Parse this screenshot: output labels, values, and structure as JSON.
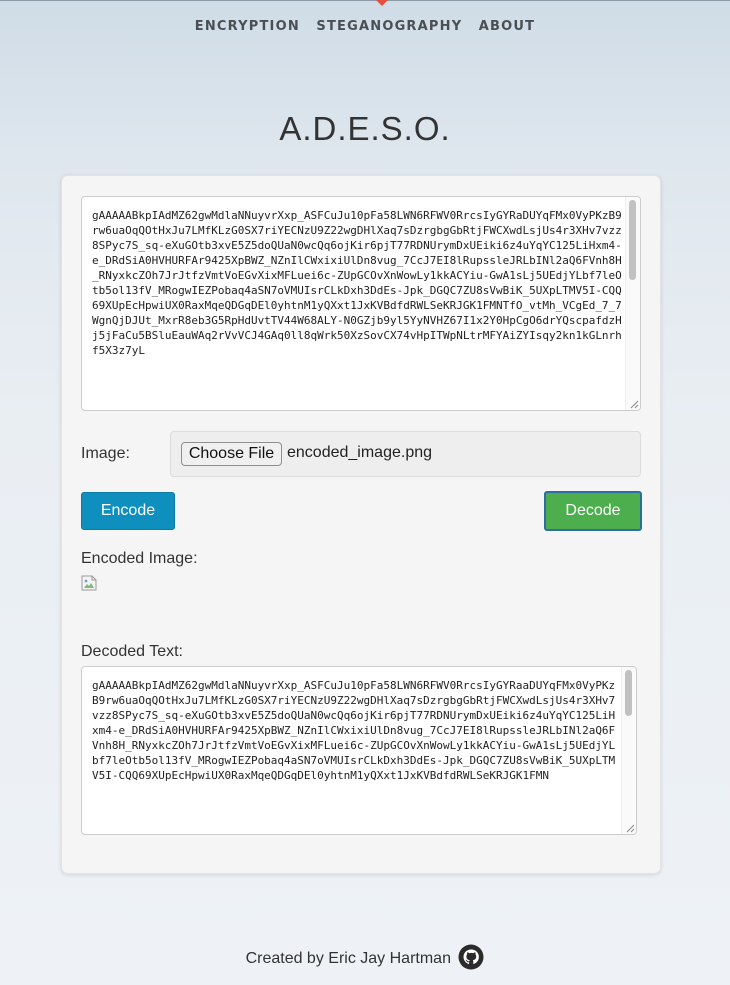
{
  "nav": {
    "items": [
      {
        "label": "ENCRYPTION"
      },
      {
        "label": "STEGANOGRAPHY"
      },
      {
        "label": "ABOUT"
      }
    ]
  },
  "title": "A.D.E.S.O.",
  "input_text": "gAAAAABkpIAdMZ62gwMdlaNNuyvrXxp_ASFCuJu10pFa58LWN6RFWV0RrcsIyGYRaDUYqFMx0VyPKzB9rw6uaOqQOtHxJu7LMfKLzG0SX7riYECNzU9Z22wgDHlXaq7sDzrgbgGbRtjFWCXwdLsjUs4r3XHv7vzz8SPyc7S_sq-eXuGOtb3xvE5Z5doQUaN0wcQq6ojKir6pjT77RDNUrymDxUEiki6z4uYqYC125LiHxm4-e_DRdSiA0HVHURFAr9425XpBWZ_NZnIlCWxixiUlDn8vug_7CcJ7EI8lRupssleJRLbINl2aQ6FVnh8H_RNyxkcZOh7JrJtfzVmtVoEGvXixMFLuei6c-ZUpGCOvXnWowLy1kkACYiu-GwA1sLj5UEdjYLbf7leOtb5ol13fV_MRogwIEZPobaq4aSN7oVMUIsrCLkDxh3DdEs-Jpk_DGQC7ZU8sVwBiK_5UXpLTMV5I-CQQ69XUpEcHpwiUX0RaxMqeQDGqDEl0yhtnM1yQXxt1JxKVBdfdRWLSeKRJGK1FMNTfO_vtMh_VCgEd_7_7WgnQjDJUt_MxrR8eb3G5RpHdUvtTV44W68ALY-N0GZjb9yl5YyNVHZ67I1x2Y0HpCgO6drYQscpafdzHj5jFaCu5BSluEauWAq2rVvVCJ4GAq0ll8qWrk50XzSovCX74vHpITWpNLtrMFYAiZYIsqy2kn1kGLnrhf5X3z7yL",
  "image": {
    "label": "Image:",
    "button_label": "Choose File",
    "file_name": "encoded_image.png"
  },
  "buttons": {
    "encode": "Encode",
    "decode": "Decode"
  },
  "encoded_image_label": "Encoded Image:",
  "decoded_text_label": "Decoded Text:",
  "decoded_text": "gAAAAABkpIAdMZ62gwMdlaNNuyvrXxp_ASFCuJu10pFa58LWN6RFWV0RrcsIyGYRaaDUYqFMx0VyPKzB9rw6uaOqQOtHxJu7LMfKLzG0SX7riYECNzU9Z22wgDHlXaq7sDzrgbgGbRtjFWCXwdLsjUs4r3XHv7vzz8SPyc7S_sq-eXuGOtb3xvE5Z5doQUaN0wcQq6ojKir6pjT77RDNUrymDxUEiki6z4uYqYC125LiHxm4-e_DRdSiA0HVHURFAr9425XpBWZ_NZnIlCWxixiUlDn8vug_7CcJ7EI8lRupssleJRLbINl2aQ6FVnh8H_RNyxkcZOh7JrJtfzVmtVoEGvXixMFLuei6c-ZUpGCOvXnWowLy1kkACYiu-GwA1sLj5UEdjYLbf7leOtb5ol13fV_MRogwIEZPobaq4aSN7oVMUIsrCLkDxh3DdEs-Jpk_DGQC7ZU8sVwBiK_5UXpLTMV5I-CQQ69XUpEcHpwiUX0RaxMqeQDGqDEl0yhtnM1yQXxt1JxKVBdfdRWLSeKRJGK1FMN",
  "footer": {
    "text": "Created by Eric Jay Hartman"
  },
  "colors": {
    "encode_button": "#0e8fbd",
    "decode_button": "#4cae4c",
    "nav_marker": "#e74c3c"
  },
  "icons": {
    "footer_icon": "github-icon",
    "encoded_image": "broken-image-icon"
  }
}
